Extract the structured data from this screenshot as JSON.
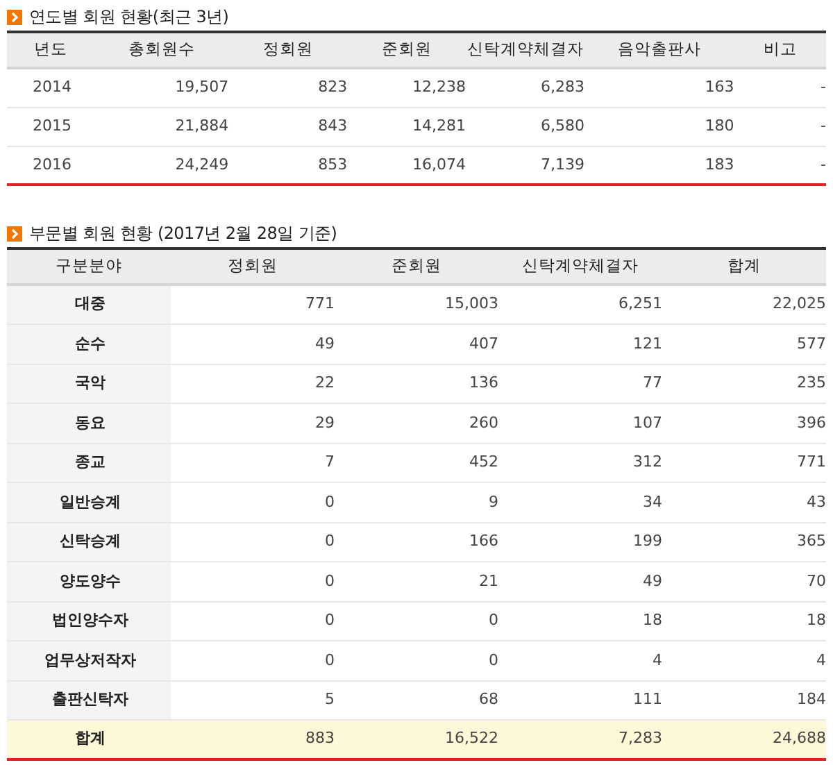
{
  "sections": [
    {
      "title": "연도별 회원 현황(최근 3년)",
      "table": {
        "columns": [
          "년도",
          "총회원수",
          "정회원",
          "준회원",
          "신탁계약체결자",
          "음악출판사",
          "비고"
        ],
        "rows": [
          {
            "kind": "data",
            "cells": [
              "2014",
              "19,507",
              "823",
              "12,238",
              "6,283",
              "163",
              "-"
            ]
          },
          {
            "kind": "data",
            "cells": [
              "2015",
              "21,884",
              "843",
              "14,281",
              "6,580",
              "180",
              "-"
            ]
          },
          {
            "kind": "data",
            "cells": [
              "2016",
              "24,249",
              "853",
              "16,074",
              "7,139",
              "183",
              "-"
            ]
          }
        ]
      }
    },
    {
      "title": "부문별 회원 현황 (2017년 2월 28일 기준)",
      "table": {
        "columns": [
          "구분분야",
          "정회원",
          "준회원",
          "신탁계약체결자",
          "합계"
        ],
        "rows": [
          {
            "kind": "data",
            "cells": [
              "대중",
              "771",
              "15,003",
              "6,251",
              "22,025"
            ]
          },
          {
            "kind": "data",
            "cells": [
              "순수",
              "49",
              "407",
              "121",
              "577"
            ]
          },
          {
            "kind": "data",
            "cells": [
              "국악",
              "22",
              "136",
              "77",
              "235"
            ]
          },
          {
            "kind": "data",
            "cells": [
              "동요",
              "29",
              "260",
              "107",
              "396"
            ]
          },
          {
            "kind": "data",
            "cells": [
              "종교",
              "7",
              "452",
              "312",
              "771"
            ]
          },
          {
            "kind": "data",
            "cells": [
              "일반승계",
              "0",
              "9",
              "34",
              "43"
            ]
          },
          {
            "kind": "data",
            "cells": [
              "신탁승계",
              "0",
              "166",
              "199",
              "365"
            ]
          },
          {
            "kind": "data",
            "cells": [
              "양도양수",
              "0",
              "21",
              "49",
              "70"
            ]
          },
          {
            "kind": "data",
            "cells": [
              "법인양수자",
              "0",
              "0",
              "18",
              "18"
            ]
          },
          {
            "kind": "data",
            "cells": [
              "업무상저작자",
              "0",
              "0",
              "4",
              "4"
            ]
          },
          {
            "kind": "data",
            "cells": [
              "출판신탁자",
              "5",
              "68",
              "111",
              "184"
            ]
          },
          {
            "kind": "total",
            "cells": [
              "합계",
              "883",
              "16,522",
              "7,283",
              "24,688"
            ]
          }
        ]
      }
    }
  ]
}
